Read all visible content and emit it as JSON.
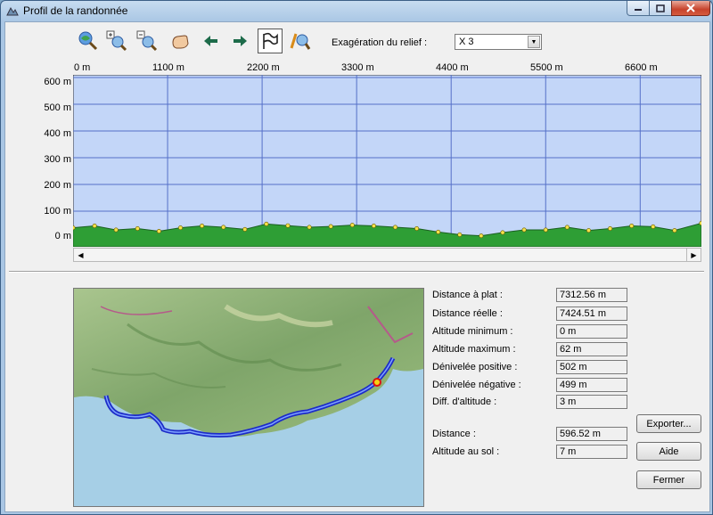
{
  "window": {
    "title": "Profil de la randonnée"
  },
  "toolbar": {
    "relief_label": "Exagération du relief :",
    "relief_value": "X 3",
    "tools": [
      "zoom-fit-icon",
      "zoom-in-icon",
      "zoom-out-icon",
      "pan-hand-icon",
      "arrow-left-icon",
      "arrow-right-icon",
      "waypoint-flag-icon",
      "profile-search-icon"
    ]
  },
  "chart_data": {
    "type": "area",
    "title": "",
    "x_ticks": [
      "0 m",
      "1100 m",
      "2200 m",
      "3300 m",
      "4400 m",
      "5500 m",
      "6600 m"
    ],
    "y_ticks": [
      "600 m",
      "500 m",
      "400 m",
      "300 m",
      "200 m",
      "100 m",
      "0 m"
    ],
    "xlim": [
      0,
      7312.56
    ],
    "ylim": [
      0,
      600
    ],
    "grid": true,
    "series": [
      {
        "x": [
          0,
          250,
          500,
          750,
          1000,
          1250,
          1500,
          1750,
          2000,
          2250,
          2500,
          2750,
          3000,
          3250,
          3500,
          3750,
          4000,
          4250,
          4500,
          4750,
          5000,
          5250,
          5500,
          5750,
          6000,
          6250,
          6500,
          6750,
          7000,
          7312
        ],
        "y": [
          38,
          45,
          30,
          35,
          25,
          38,
          45,
          40,
          32,
          52,
          46,
          40,
          43,
          48,
          45,
          40,
          35,
          22,
          12,
          8,
          20,
          30,
          30,
          40,
          28,
          35,
          45,
          42,
          28,
          55
        ]
      }
    ],
    "colors": {
      "area": "#2e9e35",
      "area_edge": "#1a5f1f",
      "marker": "#f4e24a",
      "background": "#c3d6f8",
      "grid": "#5570c8"
    }
  },
  "stats": [
    {
      "label": "Distance à plat :",
      "value": "7312.56 m"
    },
    {
      "label": "Distance réelle :",
      "value": "7424.51 m"
    },
    {
      "label": "Altitude minimum :",
      "value": "0 m"
    },
    {
      "label": "Altitude maximum :",
      "value": "62 m"
    },
    {
      "label": "Dénivelée positive :",
      "value": "502 m"
    },
    {
      "label": "Dénivelée négative :",
      "value": "499 m"
    },
    {
      "label": "Diff. d'altitude :",
      "value": "3 m"
    },
    {
      "label": "Distance :",
      "value": "596.52 m"
    },
    {
      "label": "Altitude au sol :",
      "value": "7 m"
    }
  ],
  "buttons": {
    "export": "Exporter...",
    "help": "Aide",
    "close": "Fermer"
  }
}
